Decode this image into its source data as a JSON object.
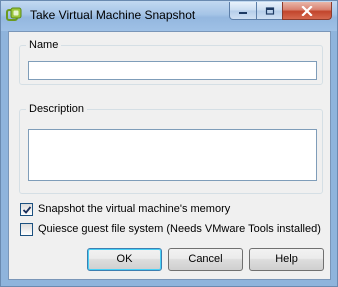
{
  "window": {
    "title": "Take Virtual Machine Snapshot",
    "app_icon": "vmware-snapshot-icon"
  },
  "caption_buttons": {
    "minimize_icon": "minimize-icon",
    "maximize_icon": "maximize-icon",
    "close_icon": "close-icon"
  },
  "name_group": {
    "label": "Name",
    "value": ""
  },
  "description_group": {
    "label": "Description",
    "value": ""
  },
  "options": [
    {
      "label": "Snapshot the virtual machine's memory",
      "checked": true
    },
    {
      "label": "Quiesce guest file system (Needs VMware Tools installed)",
      "checked": false
    }
  ],
  "buttons": {
    "ok": "OK",
    "cancel": "Cancel",
    "help": "Help"
  },
  "colors": {
    "title_bar": "#a5c4e6",
    "close_button": "#c2452c",
    "dialog_face": "#f0f0f0"
  }
}
